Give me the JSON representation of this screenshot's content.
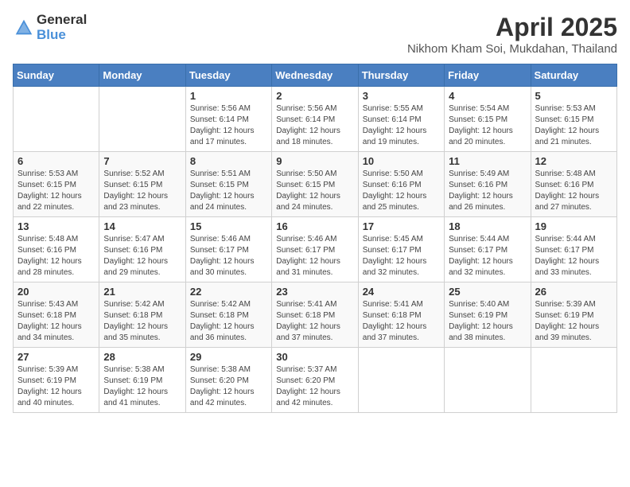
{
  "header": {
    "logo_general": "General",
    "logo_blue": "Blue",
    "month_title": "April 2025",
    "location": "Nikhom Kham Soi, Mukdahan, Thailand"
  },
  "days_of_week": [
    "Sunday",
    "Monday",
    "Tuesday",
    "Wednesday",
    "Thursday",
    "Friday",
    "Saturday"
  ],
  "weeks": [
    [
      {
        "day": "",
        "info": ""
      },
      {
        "day": "",
        "info": ""
      },
      {
        "day": "1",
        "info": "Sunrise: 5:56 AM\nSunset: 6:14 PM\nDaylight: 12 hours and 17 minutes."
      },
      {
        "day": "2",
        "info": "Sunrise: 5:56 AM\nSunset: 6:14 PM\nDaylight: 12 hours and 18 minutes."
      },
      {
        "day": "3",
        "info": "Sunrise: 5:55 AM\nSunset: 6:14 PM\nDaylight: 12 hours and 19 minutes."
      },
      {
        "day": "4",
        "info": "Sunrise: 5:54 AM\nSunset: 6:15 PM\nDaylight: 12 hours and 20 minutes."
      },
      {
        "day": "5",
        "info": "Sunrise: 5:53 AM\nSunset: 6:15 PM\nDaylight: 12 hours and 21 minutes."
      }
    ],
    [
      {
        "day": "6",
        "info": "Sunrise: 5:53 AM\nSunset: 6:15 PM\nDaylight: 12 hours and 22 minutes."
      },
      {
        "day": "7",
        "info": "Sunrise: 5:52 AM\nSunset: 6:15 PM\nDaylight: 12 hours and 23 minutes."
      },
      {
        "day": "8",
        "info": "Sunrise: 5:51 AM\nSunset: 6:15 PM\nDaylight: 12 hours and 24 minutes."
      },
      {
        "day": "9",
        "info": "Sunrise: 5:50 AM\nSunset: 6:15 PM\nDaylight: 12 hours and 24 minutes."
      },
      {
        "day": "10",
        "info": "Sunrise: 5:50 AM\nSunset: 6:16 PM\nDaylight: 12 hours and 25 minutes."
      },
      {
        "day": "11",
        "info": "Sunrise: 5:49 AM\nSunset: 6:16 PM\nDaylight: 12 hours and 26 minutes."
      },
      {
        "day": "12",
        "info": "Sunrise: 5:48 AM\nSunset: 6:16 PM\nDaylight: 12 hours and 27 minutes."
      }
    ],
    [
      {
        "day": "13",
        "info": "Sunrise: 5:48 AM\nSunset: 6:16 PM\nDaylight: 12 hours and 28 minutes."
      },
      {
        "day": "14",
        "info": "Sunrise: 5:47 AM\nSunset: 6:16 PM\nDaylight: 12 hours and 29 minutes."
      },
      {
        "day": "15",
        "info": "Sunrise: 5:46 AM\nSunset: 6:17 PM\nDaylight: 12 hours and 30 minutes."
      },
      {
        "day": "16",
        "info": "Sunrise: 5:46 AM\nSunset: 6:17 PM\nDaylight: 12 hours and 31 minutes."
      },
      {
        "day": "17",
        "info": "Sunrise: 5:45 AM\nSunset: 6:17 PM\nDaylight: 12 hours and 32 minutes."
      },
      {
        "day": "18",
        "info": "Sunrise: 5:44 AM\nSunset: 6:17 PM\nDaylight: 12 hours and 32 minutes."
      },
      {
        "day": "19",
        "info": "Sunrise: 5:44 AM\nSunset: 6:17 PM\nDaylight: 12 hours and 33 minutes."
      }
    ],
    [
      {
        "day": "20",
        "info": "Sunrise: 5:43 AM\nSunset: 6:18 PM\nDaylight: 12 hours and 34 minutes."
      },
      {
        "day": "21",
        "info": "Sunrise: 5:42 AM\nSunset: 6:18 PM\nDaylight: 12 hours and 35 minutes."
      },
      {
        "day": "22",
        "info": "Sunrise: 5:42 AM\nSunset: 6:18 PM\nDaylight: 12 hours and 36 minutes."
      },
      {
        "day": "23",
        "info": "Sunrise: 5:41 AM\nSunset: 6:18 PM\nDaylight: 12 hours and 37 minutes."
      },
      {
        "day": "24",
        "info": "Sunrise: 5:41 AM\nSunset: 6:18 PM\nDaylight: 12 hours and 37 minutes."
      },
      {
        "day": "25",
        "info": "Sunrise: 5:40 AM\nSunset: 6:19 PM\nDaylight: 12 hours and 38 minutes."
      },
      {
        "day": "26",
        "info": "Sunrise: 5:39 AM\nSunset: 6:19 PM\nDaylight: 12 hours and 39 minutes."
      }
    ],
    [
      {
        "day": "27",
        "info": "Sunrise: 5:39 AM\nSunset: 6:19 PM\nDaylight: 12 hours and 40 minutes."
      },
      {
        "day": "28",
        "info": "Sunrise: 5:38 AM\nSunset: 6:19 PM\nDaylight: 12 hours and 41 minutes."
      },
      {
        "day": "29",
        "info": "Sunrise: 5:38 AM\nSunset: 6:20 PM\nDaylight: 12 hours and 42 minutes."
      },
      {
        "day": "30",
        "info": "Sunrise: 5:37 AM\nSunset: 6:20 PM\nDaylight: 12 hours and 42 minutes."
      },
      {
        "day": "",
        "info": ""
      },
      {
        "day": "",
        "info": ""
      },
      {
        "day": "",
        "info": ""
      }
    ]
  ]
}
